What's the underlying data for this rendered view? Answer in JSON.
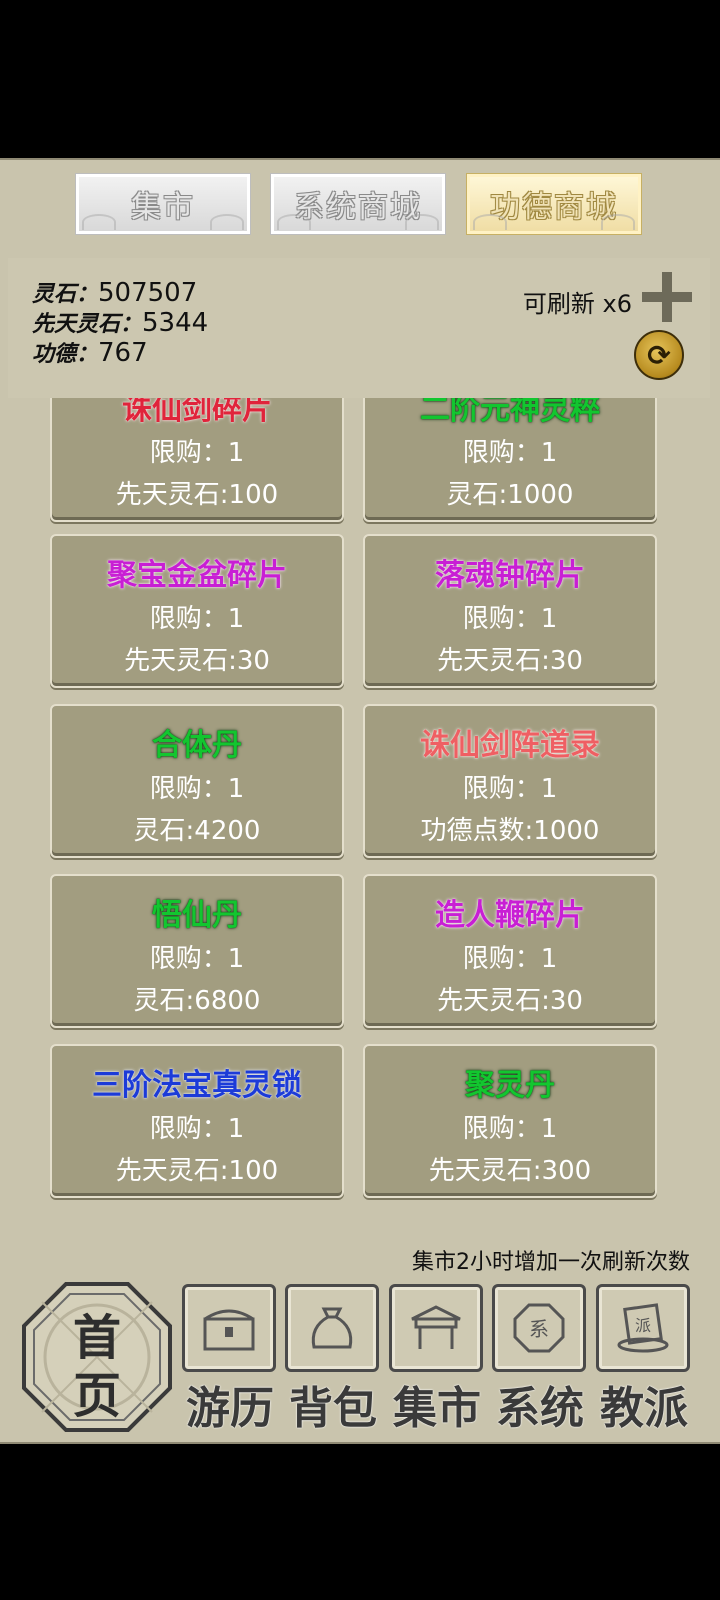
{
  "tabs": [
    {
      "label": "集市"
    },
    {
      "label": "系统商城"
    },
    {
      "label": "功德商城"
    }
  ],
  "active_tab": "功德商城",
  "currency": {
    "spirit_stone_label": "灵石：",
    "spirit_stone_value": "507507",
    "innate_stone_label": "先天灵石：",
    "innate_stone_value": "5344",
    "merit_label": "功德：",
    "merit_value": "767",
    "refresh_text": "可刷新 x6"
  },
  "items": [
    {
      "name": "诛仙剑碎片",
      "limit": "限购：1",
      "price": "先天灵石:100",
      "color": "#e0243b"
    },
    {
      "name": "二阶元神灵粹",
      "limit": "限购：1",
      "price": "灵石:1000",
      "color": "#12c62f"
    },
    {
      "name": "聚宝金盆碎片",
      "limit": "限购：1",
      "price": "先天灵石:30",
      "color": "#c81fd4"
    },
    {
      "name": "落魂钟碎片",
      "limit": "限购：1",
      "price": "先天灵石:30",
      "color": "#c81fd4"
    },
    {
      "name": "合体丹",
      "limit": "限购：1",
      "price": "灵石:4200",
      "color": "#12c62f"
    },
    {
      "name": "诛仙剑阵道录",
      "limit": "限购：1",
      "price": "功德点数:1000",
      "color": "#ef5f63"
    },
    {
      "name": "悟仙丹",
      "limit": "限购：1",
      "price": "灵石:6800",
      "color": "#12c62f"
    },
    {
      "name": "造人鞭碎片",
      "limit": "限购：1",
      "price": "先天灵石:30",
      "color": "#c81fd4"
    },
    {
      "name": "三阶法宝真灵锁",
      "limit": "限购：1",
      "price": "先天灵石:100",
      "color": "#1c3bd8"
    },
    {
      "name": "聚灵丹",
      "limit": "限购：1",
      "price": "先天灵石:300",
      "color": "#12c62f"
    }
  ],
  "note": "集市2小时增加一次刷新次数",
  "nav": {
    "home_line1": "首",
    "home_line2": "页",
    "items": [
      {
        "label": "游历",
        "icon": "chest-icon"
      },
      {
        "label": "背包",
        "icon": "bag-icon"
      },
      {
        "label": "集市",
        "icon": "stall-icon"
      },
      {
        "label": "系统",
        "icon": "system-seal-icon"
      },
      {
        "label": "教派",
        "icon": "sect-scroll-icon"
      }
    ]
  }
}
